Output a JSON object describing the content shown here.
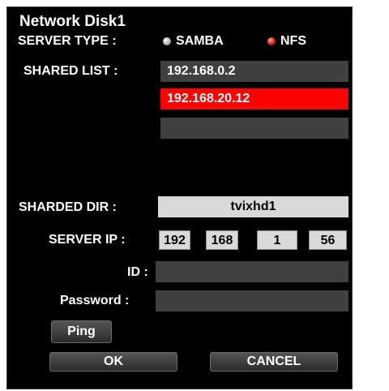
{
  "title": "Network Disk1",
  "server_type": {
    "label": "SERVER TYPE :",
    "options": [
      {
        "label": "SAMBA",
        "selected": false
      },
      {
        "label": "NFS",
        "selected": true
      }
    ]
  },
  "shared_list": {
    "label": "SHARED LIST :",
    "items": [
      "192.168.0.2",
      "192.168.20.12",
      ""
    ],
    "selected_index": 1
  },
  "shared_dir": {
    "label": "SHARDED DIR :",
    "value": "tvixhd1"
  },
  "server_ip": {
    "label": "SERVER IP :",
    "octets": [
      "192",
      "168",
      "1",
      "56"
    ]
  },
  "id": {
    "label": "ID :",
    "value": ""
  },
  "password": {
    "label": "Password :",
    "value": ""
  },
  "buttons": {
    "ping": "Ping",
    "ok": "OK",
    "cancel": "CANCEL"
  },
  "colors": {
    "background": "#000000",
    "selected": "#ff0000",
    "field": "#404040",
    "light_field": "#d9d9d9",
    "radio_on": "#cc1010"
  }
}
